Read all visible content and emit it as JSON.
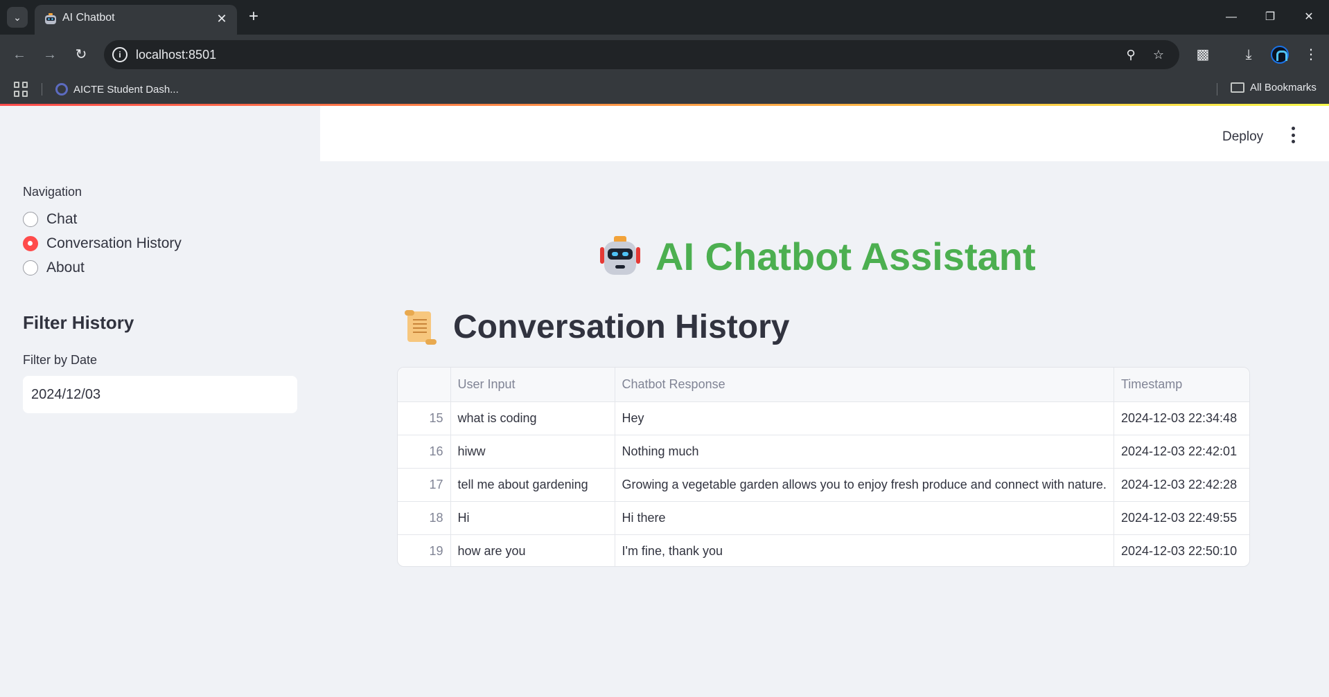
{
  "browser": {
    "tab_title": "AI Chatbot",
    "url": "localhost:8501",
    "bookmarks": [
      {
        "label": "AICTE Student Dash..."
      }
    ],
    "all_bookmarks_label": "All Bookmarks"
  },
  "app_header": {
    "deploy_label": "Deploy"
  },
  "sidebar": {
    "nav_label": "Navigation",
    "nav_options": [
      {
        "label": "Chat",
        "selected": false
      },
      {
        "label": "Conversation History",
        "selected": true
      },
      {
        "label": "About",
        "selected": false
      }
    ],
    "filter_title": "Filter History",
    "filter_label": "Filter by Date",
    "filter_value": "2024/12/03"
  },
  "main": {
    "app_title": "AI Chatbot Assistant",
    "section_title": "Conversation History",
    "table": {
      "columns": [
        "",
        "User Input",
        "Chatbot Response",
        "Timestamp"
      ],
      "rows": [
        {
          "index": "15",
          "user_input": "what is coding",
          "response": "Hey",
          "timestamp": "2024-12-03 22:34:48"
        },
        {
          "index": "16",
          "user_input": "hiww",
          "response": "Nothing much",
          "timestamp": "2024-12-03 22:42:01"
        },
        {
          "index": "17",
          "user_input": "tell me about gardening",
          "response": "Growing a vegetable garden allows you to enjoy fresh produce and connect with nature.",
          "timestamp": "2024-12-03 22:42:28"
        },
        {
          "index": "18",
          "user_input": "Hi",
          "response": "Hi there",
          "timestamp": "2024-12-03 22:49:55"
        },
        {
          "index": "19",
          "user_input": "how are you",
          "response": "I'm fine, thank you",
          "timestamp": "2024-12-03 22:50:10"
        }
      ]
    }
  },
  "colors": {
    "title_green": "#4caf50",
    "radio_selected": "#ff4b4b",
    "text": "#31333f"
  }
}
